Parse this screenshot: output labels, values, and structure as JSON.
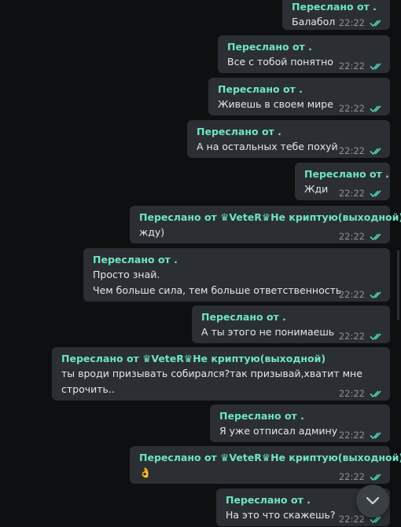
{
  "messages": [
    {
      "forwarded": "Переслано от .",
      "text": [
        "Балабол"
      ],
      "time": "22:22"
    },
    {
      "forwarded": "Переслано от .",
      "text": [
        "Все с тобой понятно"
      ],
      "time": "22:22"
    },
    {
      "forwarded": "Переслано от .",
      "text": [
        "Живешь в своем мире"
      ],
      "time": "22:22"
    },
    {
      "forwarded": "Переслано от .",
      "text": [
        "А на остальных тебе похуй"
      ],
      "time": "22:22"
    },
    {
      "forwarded": "Переслано от .",
      "text": [
        "Жди"
      ],
      "time": "22:22"
    },
    {
      "forwarded": "Переслано от ♛VeteR♛Не криптую(выходной)",
      "text": [
        "жду)"
      ],
      "time": "22:22"
    },
    {
      "forwarded": "Переслано от .",
      "text": [
        "Просто знай.",
        "Чем больше сила, тем больше ответственность"
      ],
      "time": "22:22"
    },
    {
      "forwarded": "Переслано от .",
      "text": [
        "А ты этого не понимаешь"
      ],
      "time": "22:22"
    },
    {
      "forwarded": "Переслано от ♛VeteR♛Не криптую(выходной)",
      "text": [
        "ты вроди призывать собирался?так призывай,хватит мне",
        "строчить.."
      ],
      "time": "22:22"
    },
    {
      "forwarded": "Переслано от .",
      "text": [
        "Я уже отписал админу"
      ],
      "time": "22:22"
    },
    {
      "forwarded": "Переслано от ♛VeteR♛Не криптую(выходной)",
      "text": [
        "👌"
      ],
      "time": "22:22"
    },
    {
      "forwarded": "Переслано от .",
      "text": [
        "На это что скажешь?"
      ],
      "time": "22:22"
    }
  ],
  "colors": {
    "accent": "#6fe5c0",
    "bubble": "#2b2f33",
    "background": "#0e0f10",
    "read_check": "#4fd3b4"
  },
  "icons": {
    "read_status": "double-check-icon",
    "scroll_button": "chevron-down-icon"
  }
}
